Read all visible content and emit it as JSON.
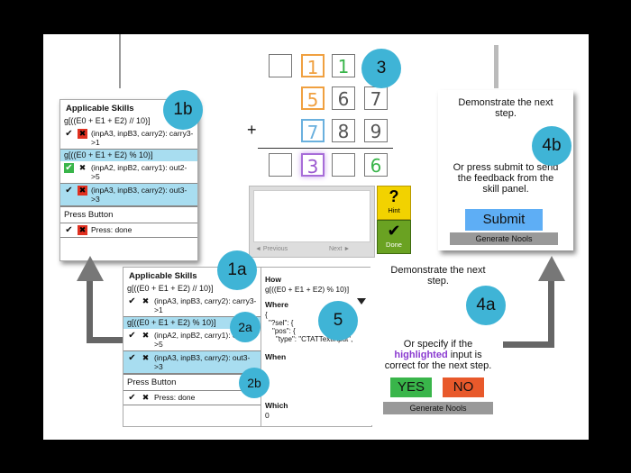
{
  "problem": {
    "plus": "+",
    "top_row": [
      "",
      "1",
      "1"
    ],
    "row_1": [
      "5",
      "6",
      "7"
    ],
    "row_2": [
      "7",
      "8",
      "9"
    ],
    "answer_row": [
      "",
      "3",
      "",
      "6"
    ]
  },
  "badges": {
    "b3": "3",
    "b1b": "1b",
    "b1a": "1a",
    "b4b": "4b",
    "b4a": "4a",
    "b5": "5",
    "b2a": "2a",
    "b2b": "2b"
  },
  "tutor": {
    "hint": "Hint",
    "hint_icon": "?",
    "done": "Done",
    "done_icon": "✔",
    "previous": "◄ Previous",
    "next": "Next ►"
  },
  "skills_1b": {
    "title": "Applicable Skills",
    "skill_1": "g[((E0 + E1 + E2) // 10)]",
    "skill_2": "g[((E0 + E1 + E2) % 10)]",
    "rows": [
      {
        "text": "(inpA3, inpB3, carry2): carry3->1",
        "check": "✔",
        "x": "✖"
      },
      {
        "text": "(inpA2, inpB2, carry1): out2->5",
        "check": "✔",
        "x": "✖"
      },
      {
        "text": "(inpA3, inpB3, carry2): out3->3",
        "check": "✔",
        "x": "✖"
      }
    ],
    "press_title": "Press Button",
    "press_row": "Press: done"
  },
  "skills_main": {
    "title": "Applicable Skills",
    "skill_1": "g[((E0 + E1 + E2) // 10)]",
    "skill_2": "g[((E0 + E1 + E2) % 10)]",
    "rows": [
      {
        "text": "(inpA3, inpB3, carry2): carry3->1",
        "check": "✔",
        "x": "✖"
      },
      {
        "text": "(inpA2, inpB2, carry1): out2->5",
        "check": "✔",
        "x": "✖"
      },
      {
        "text": "(inpA3, inpB3, carry2): out3->3",
        "check": "✔",
        "x": "✖"
      }
    ],
    "press_title": "Press Button",
    "press_row": "Press: done"
  },
  "detail": {
    "how": "How",
    "how_value": "g[((E0 + E1 + E2) % 10)]",
    "where": "Where",
    "where_line1": "{",
    "where_line2": "\"?sel\": {",
    "where_line3": "\"pos\": {",
    "where_line4": "\"type\": \"CTATTextInput\",",
    "when": "When",
    "which": "Which",
    "which_value": "0"
  },
  "panel_4b": {
    "line1": "Demonstrate the next",
    "line2": "step.",
    "or1": "Or press submit to send",
    "or2": "the feedback from the",
    "or3": "skill panel.",
    "submit": "Submit",
    "generate": "Generate Nools"
  },
  "panel_4a": {
    "line1": "Demonstrate the next",
    "line2": "step.",
    "or1": "Or specify if the",
    "hl_word": "highlighted",
    "or2_rest": " input is",
    "or3": "correct for the next step.",
    "yes": "YES",
    "no": "NO",
    "generate": "Generate Nools"
  },
  "colors": {
    "badge": "#3fb4d6",
    "yes": "#39b54a",
    "no": "#e8592b",
    "submit": "#5eaef5",
    "hint": "#f2d200",
    "done": "#6aa222",
    "highlight": "#a8ddf0"
  }
}
